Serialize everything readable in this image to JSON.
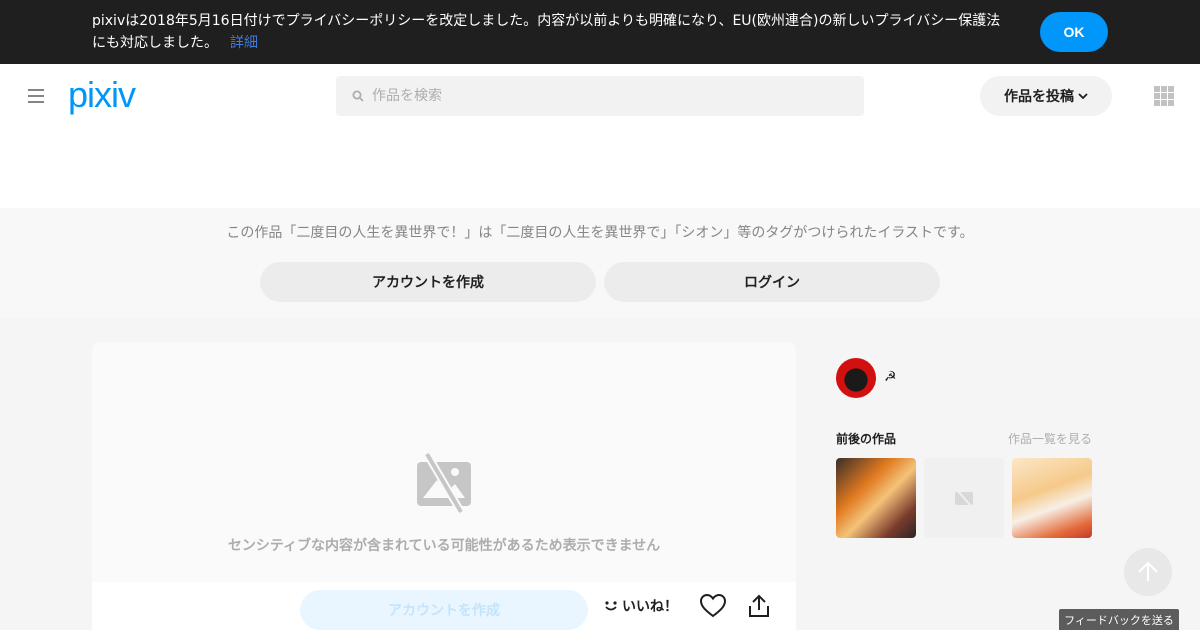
{
  "banner": {
    "text": "pixivは2018年5月16日付けでプライバシーポリシーを改定しました。内容が以前よりも明確になり、EU(欧州連合)の新しいプライバシー保護法にも対応しました。",
    "link_label": "詳細",
    "ok_label": "OK"
  },
  "header": {
    "logo": "pixiv",
    "search_placeholder": "作品を検索",
    "post_label": "作品を投稿"
  },
  "tags": {
    "description": "この作品「二度目の人生を異世界で！」は「二度目の人生を異世界で」「シオン」等のタグがつけられたイラストです。",
    "create_account_label": "アカウントを作成",
    "login_label": "ログイン"
  },
  "artwork": {
    "sensitive_message": "センシティブな内容が含まれている可能性があるため表示できません",
    "create_account_label": "アカウントを作成",
    "like_label": "いいね！"
  },
  "sidebar": {
    "author_name": "☭",
    "works_label": "前後の作品",
    "works_link": "作品一覧を見る"
  },
  "footer": {
    "feedback_label": "フィードバックを送る"
  },
  "colors": {
    "brand": "#0096fa",
    "banner_bg": "#1f1f1f"
  }
}
